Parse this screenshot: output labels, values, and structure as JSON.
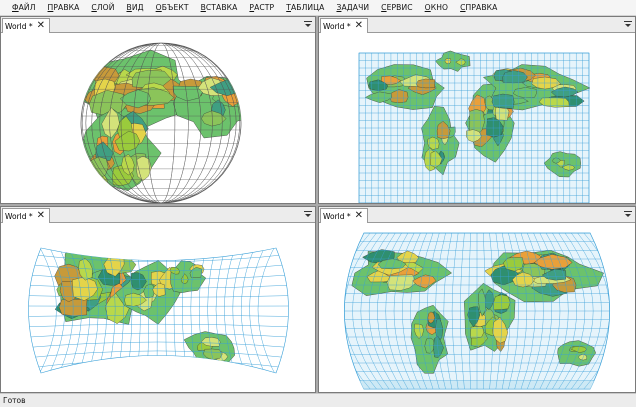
{
  "menu": [
    "ФАЙЛ",
    "ПРАВКА",
    "СЛОЙ",
    "ВИД",
    "ОБЪЕКТ",
    "ВСТАВКА",
    "РАСТР",
    "ТАБЛИЦА",
    "ЗАДАЧИ",
    "СЕРВИС",
    "ОКНО",
    "СПРАВКА"
  ],
  "windows": [
    {
      "tab_label": "World *",
      "projection": "orthographic"
    },
    {
      "tab_label": "World *",
      "projection": "mercator"
    },
    {
      "tab_label": "World *",
      "projection": "interrupted"
    },
    {
      "tab_label": "World *",
      "projection": "robinson"
    }
  ],
  "status": {
    "text": "Готов"
  },
  "colors": {
    "graticule": "#3aa0d8",
    "ocean_fill": "#e6f4fb",
    "land_palette": [
      "#6cc26c",
      "#b9d84b",
      "#e4d44a",
      "#3f9f82",
      "#e9a03a",
      "#8bc45a",
      "#2f8f6f",
      "#d4e37a",
      "#9acb3c",
      "#c79a3a"
    ]
  }
}
